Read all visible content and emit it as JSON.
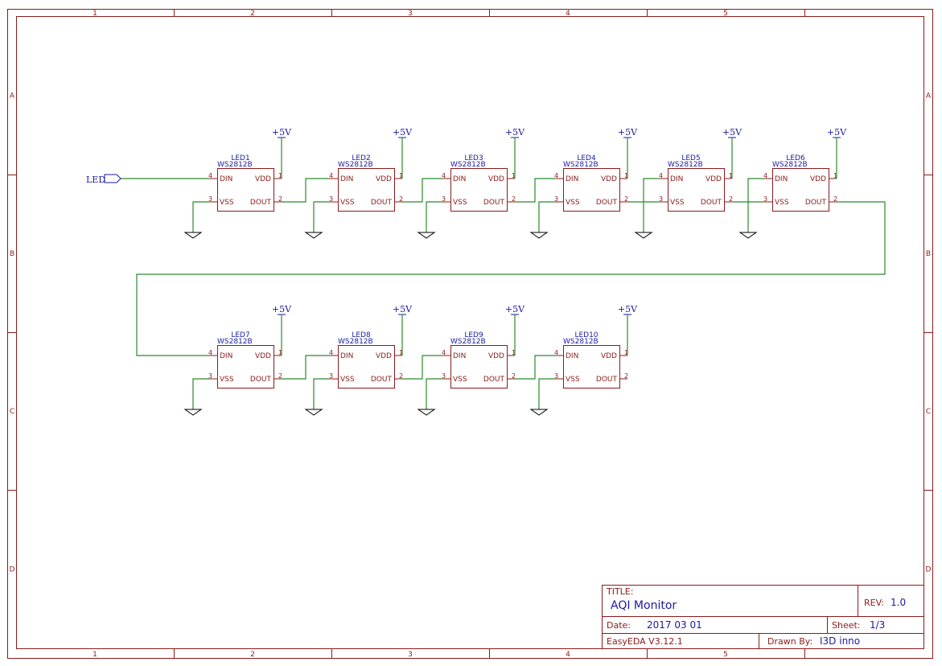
{
  "sheet_frame": {
    "columns": [
      "1",
      "2",
      "3",
      "4",
      "5"
    ],
    "rows": [
      "A",
      "B",
      "C",
      "D"
    ]
  },
  "net_port": {
    "label": "LED"
  },
  "power_label": "+5V",
  "component_value": "WS2812B",
  "pins": {
    "din": {
      "name": "DIN",
      "number": "4"
    },
    "vdd": {
      "name": "VDD",
      "number": "1"
    },
    "vss": {
      "name": "VSS",
      "number": "3"
    },
    "dout": {
      "name": "DOUT",
      "number": "2"
    }
  },
  "leds": [
    {
      "ref": "LED1"
    },
    {
      "ref": "LED2"
    },
    {
      "ref": "LED3"
    },
    {
      "ref": "LED4"
    },
    {
      "ref": "LED5"
    },
    {
      "ref": "LED6"
    },
    {
      "ref": "LED7"
    },
    {
      "ref": "LED8"
    },
    {
      "ref": "LED9"
    },
    {
      "ref": "LED10"
    }
  ],
  "title_block": {
    "title_label": "TITLE:",
    "title": "AQI Monitor",
    "rev_label": "REV:",
    "rev": "1.0",
    "date_label": "Date:",
    "date": "2017 03 01",
    "sheet_label": "Sheet:",
    "sheet": "1/3",
    "tool": "EasyEDA V3.12.1",
    "drawn_by_label": "Drawn By:",
    "drawn_by": "I3D inno"
  }
}
